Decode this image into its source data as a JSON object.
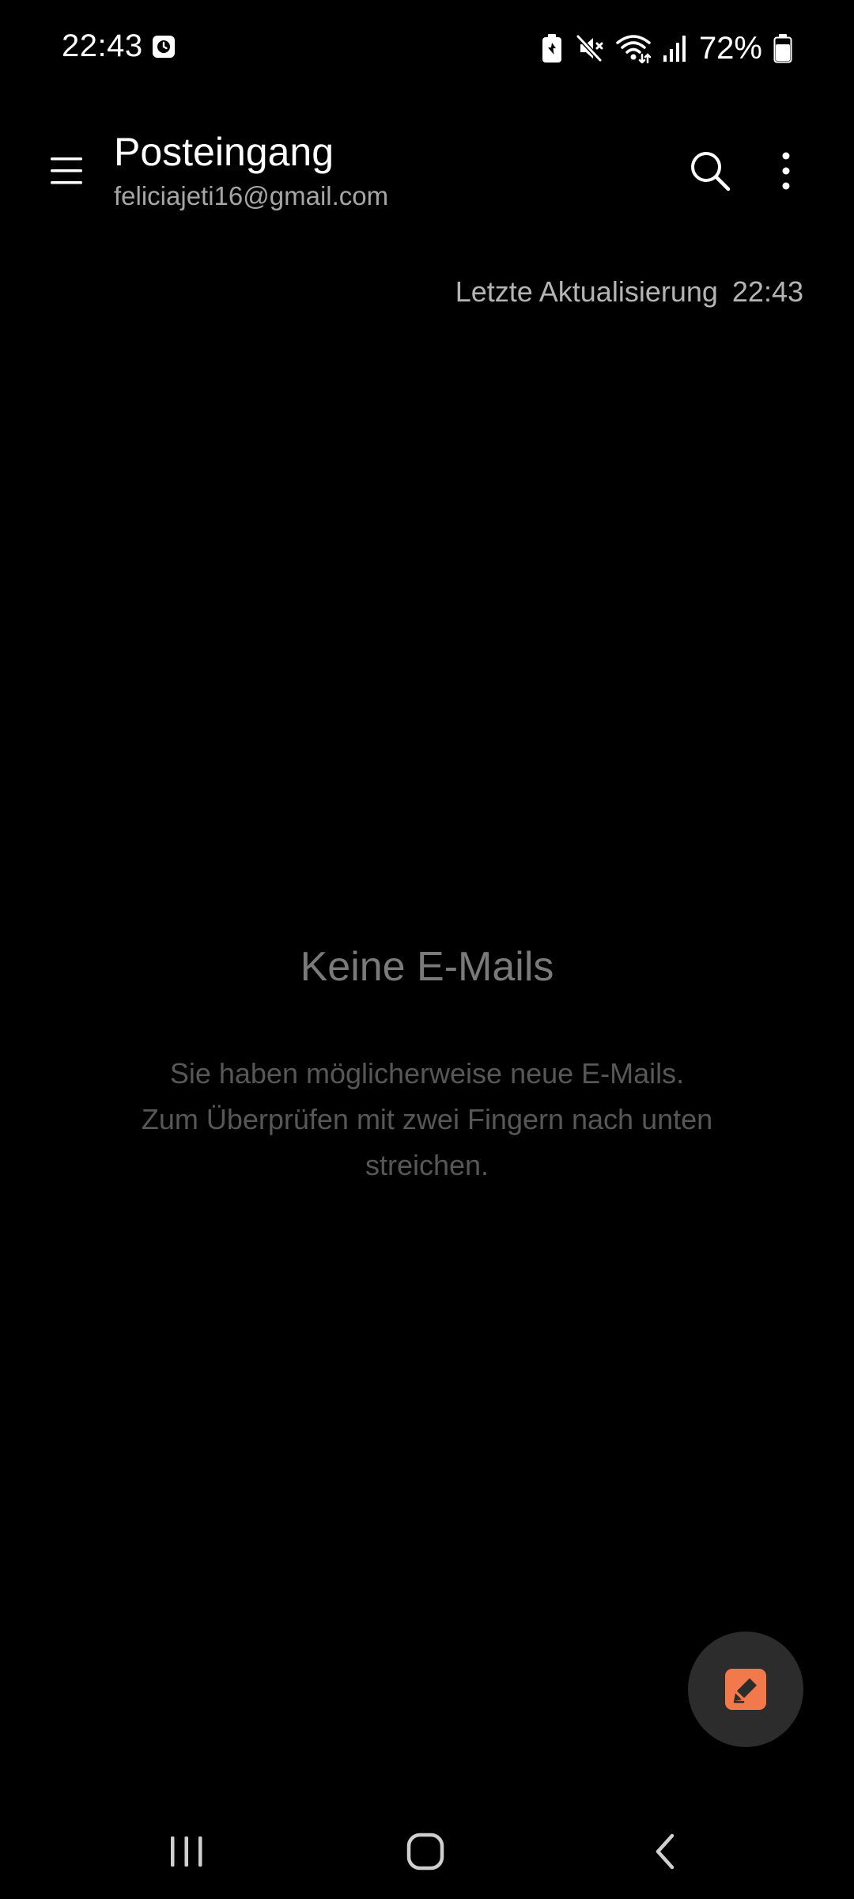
{
  "status_bar": {
    "time": "22:43",
    "battery_percent": "72%",
    "icons": [
      "clock-icon",
      "battery-saver-icon",
      "mute-icon",
      "wifi-icon",
      "signal-icon",
      "battery-icon"
    ]
  },
  "app_bar": {
    "title": "Posteingang",
    "account": "feliciajeti16@gmail.com"
  },
  "sync": {
    "label": "Letzte Aktualisierung",
    "time": "22:43"
  },
  "empty_state": {
    "title": "Keine E-Mails",
    "line1": "Sie haben möglicherweise neue E-Mails.",
    "line2": "Zum Überprüfen mit zwei Fingern nach unten streichen."
  },
  "fab": {
    "icon": "compose-icon",
    "accent_color": "#f2794c"
  },
  "nav_bar": {
    "icons": [
      "recents-icon",
      "home-icon",
      "back-icon"
    ]
  }
}
